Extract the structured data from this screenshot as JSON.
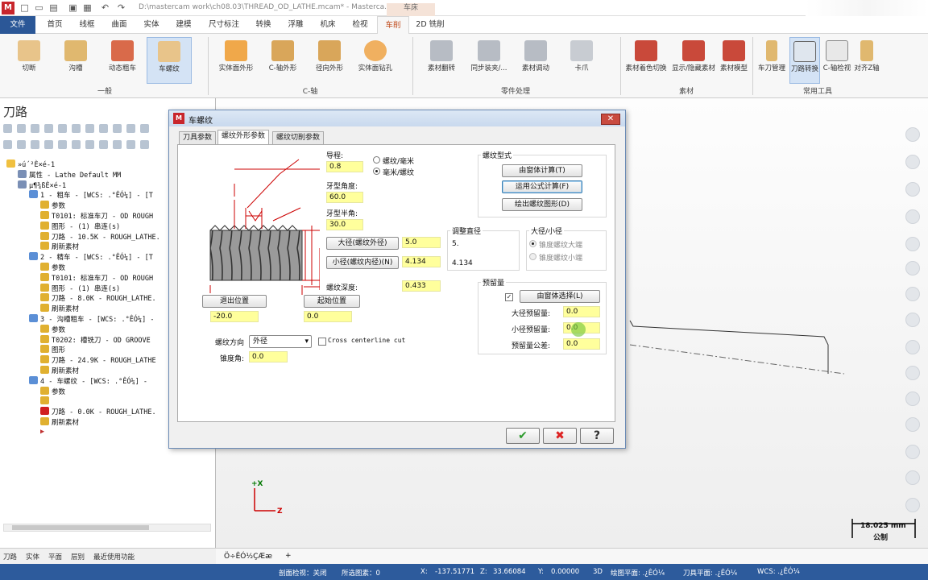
{
  "title_bar": {
    "path": "D:\\mastercam work\\ch08.03\\THREAD_OD_LATHE.mcam* - Masterca...",
    "context_tab": "车床"
  },
  "ribbon_tabs": [
    "文件",
    "首页",
    "线框",
    "曲面",
    "实体",
    "建模",
    "尺寸标注",
    "转换",
    "浮雕",
    "机床",
    "检视",
    "车削",
    "2D 铣削"
  ],
  "ribbon": {
    "groups": [
      {
        "label": "一般",
        "buttons": [
          "切断",
          "沟槽",
          "动态粗车",
          "车螺纹"
        ]
      },
      {
        "label": "C-轴",
        "buttons": [
          "实体面外形",
          "C-轴外形",
          "径向外形",
          "实体面钻孔"
        ]
      },
      {
        "label": "零件处理",
        "buttons": [
          "素材翻转",
          "同步装夹/...",
          "素材调动",
          "卡爪"
        ]
      },
      {
        "label": "素材",
        "buttons": [
          "素材着色切换",
          "显示/隐藏素材",
          "素材模型"
        ]
      },
      {
        "label": "常用工具",
        "buttons": [
          "车刀管理",
          "刀路转换",
          "C-轴检视",
          "对齐Z轴"
        ]
      }
    ]
  },
  "left_panel": {
    "title": "刀路",
    "tree": [
      {
        "level": 0,
        "text": "»ú´²È×é-1"
      },
      {
        "level": 1,
        "text": "属性 - Lathe Default MM"
      },
      {
        "level": 1,
        "text": "µ¶¾ßÈ×é-1"
      },
      {
        "level": 2,
        "text": "1 - 粗车 - [WCS: .°ÊÓ¼] - [T"
      },
      {
        "level": 3,
        "text": "参数"
      },
      {
        "level": 3,
        "text": "T0101: 标准车刀 - OD ROUGH"
      },
      {
        "level": 3,
        "text": "图形 - (1) 串连(s)"
      },
      {
        "level": 3,
        "text": "刀路 - 10.5K - ROUGH_LATHE."
      },
      {
        "level": 3,
        "text": "刷新素材"
      },
      {
        "level": 2,
        "text": "2 - 精车 - [WCS: .°ÊÓ¼] - [T"
      },
      {
        "level": 3,
        "text": "参数"
      },
      {
        "level": 3,
        "text": "T0101: 标准车刀 - OD ROUGH"
      },
      {
        "level": 3,
        "text": "图形 - (1) 串连(s)"
      },
      {
        "level": 3,
        "text": "刀路 - 8.0K - ROUGH_LATHE."
      },
      {
        "level": 3,
        "text": "刷新素材"
      },
      {
        "level": 2,
        "text": "3 - 沟槽粗车 - [WCS: .°ÊÓ¼] -"
      },
      {
        "level": 3,
        "text": "参数"
      },
      {
        "level": 3,
        "text": "T0202: 槽铣刀 - OD GROOVE"
      },
      {
        "level": 3,
        "text": "图形"
      },
      {
        "level": 3,
        "text": "刀路 - 24.9K - ROUGH_LATHE"
      },
      {
        "level": 3,
        "text": "刷新素材"
      },
      {
        "level": 2,
        "text": "4 - 车螺纹 - [WCS: .°ÊÓ¼] -"
      },
      {
        "level": 3,
        "text": "参数"
      },
      {
        "level": 3,
        "text": ""
      },
      {
        "level": 3,
        "text": "刀路 - 0.0K - ROUGH_LATHE."
      },
      {
        "level": 3,
        "text": "刷新素材"
      }
    ],
    "bottom_tabs": [
      "刀路",
      "实体",
      "平面",
      "层别",
      "最近使用功能"
    ]
  },
  "viewport": {
    "axis_x": "+X",
    "axis_z": "Z",
    "scale_value": "18.025 mm",
    "scale_unit": "公制",
    "tab_label": "Ö÷ÊÓ½ÇÆæ"
  },
  "status_bar": {
    "section_view": "剖面检视：关闭",
    "selected": "所选图素：0",
    "x_label": "X:",
    "x": "-137.51771",
    "z_label": "Z:",
    "z": "33.66084",
    "y_label": "Y:",
    "y": "0.00000",
    "mode": "3D",
    "draw_plane": "绘图平面: .¿ÊÓ¼",
    "tool_plane": "刀具平面: .¿ÊÓ¼",
    "wcs": "WCS: .¿ÊÓ¼"
  },
  "dialog": {
    "title": "车螺纹",
    "tabs": [
      "刀具参数",
      "螺纹外形参数",
      "螺纹切削参数"
    ],
    "lead_label": "导程:",
    "lead": "0.8",
    "unit_opt1": "螺纹/毫米",
    "unit_opt2": "毫米/螺纹",
    "included_angle_label": "牙型角度:",
    "included_angle": "60.0",
    "half_angle_label": "牙型半角:",
    "half_angle": "30.0",
    "major_btn": "大径(螺纹外径)",
    "major": "5.0",
    "minor_btn": "小径(螺纹内径)(N)",
    "minor": "4.134",
    "depth_label": "螺纹深度:",
    "depth": "0.433",
    "end_btn": "退出位置",
    "end": "-20.0",
    "start_btn": "起始位置",
    "start": "0.0",
    "direction_label": "螺纹方向",
    "direction": "外径",
    "cross_centerline": "Cross centerline cut",
    "taper_label": "锥度角:",
    "taper": "0.0",
    "adjust_label": "调整直径",
    "adjust_v1": "5.",
    "adjust_v2": "4.134",
    "majmin_label": "大径/小径",
    "majmin_opt1": "锥度螺纹大端",
    "majmin_opt2": "锥度螺纹小端",
    "form_label": "螺纹型式",
    "form_btn1": "由窗体计算(T)",
    "form_btn2": "运用公式计算(F)",
    "form_btn3": "绘出螺纹图形(D)",
    "allow_label": "预留量",
    "allow_btn": "由窗体选择(L)",
    "allow_major_label": "大径预留量:",
    "allow_major": "0.0",
    "allow_minor_label": "小径预留量:",
    "allow_minor": "0.0",
    "allow_tol_label": "预留量公差:",
    "allow_tol": "0.0",
    "ok": "✔",
    "cancel": "✖",
    "help": "?"
  },
  "colors": {
    "brand": "#c8262c",
    "file_tab": "#2b5797",
    "status_bar": "#2d5b9c",
    "field": "#ffff9c"
  }
}
